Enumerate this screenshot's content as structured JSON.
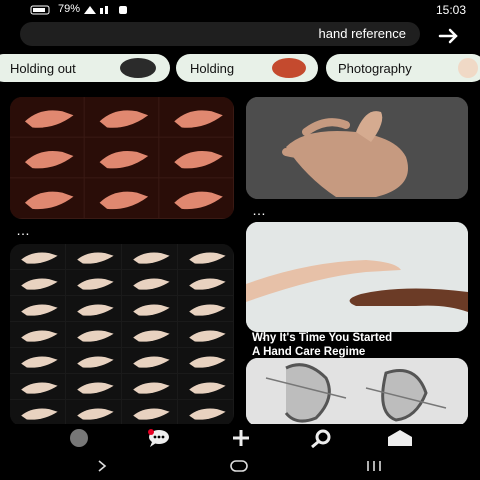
{
  "status_bar": {
    "time": "15:03",
    "battery": "79%"
  },
  "search": {
    "query": "hand reference"
  },
  "chips": [
    {
      "label": "Photography",
      "thumb_color": "#f0d9c6"
    },
    {
      "label": "Holding",
      "thumb_color": "#c44a2e"
    },
    {
      "label": "Holding out",
      "thumb_color": "#2b2b2b"
    }
  ],
  "pins": {
    "left_1_more": "…",
    "left_2_more": "…",
    "right_1_more": "…",
    "right_2_more": "…",
    "right_2_caption_line1": "Why It's Time You Started",
    "right_2_caption_line2": "A Hand Care Regime"
  },
  "bottom_nav": [
    {
      "name": "home-icon"
    },
    {
      "name": "search-icon"
    },
    {
      "name": "create-icon"
    },
    {
      "name": "messages-icon"
    },
    {
      "name": "profile-icon"
    }
  ],
  "colors": {
    "chip_bg": "#e8f1e8",
    "search_bg": "#1f1f1f",
    "accent": "#e60023"
  }
}
